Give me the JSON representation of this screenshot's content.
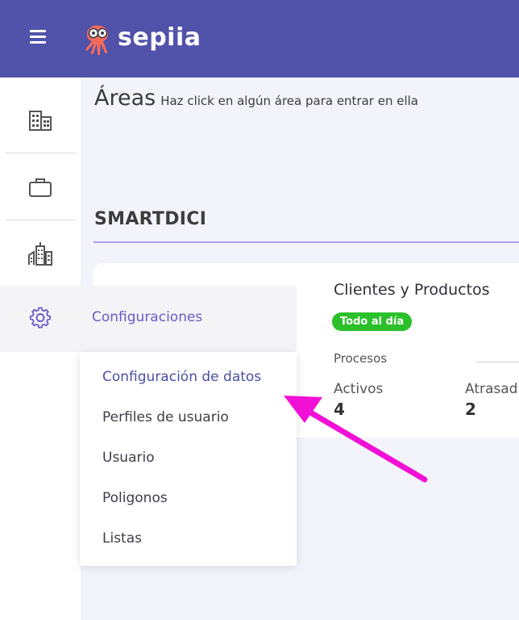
{
  "header": {
    "brand": "sepiia",
    "menu_icon": "hamburger-menu-icon",
    "logo_icon": "octopus-logo-icon",
    "background_color": "#5152a9"
  },
  "sidebar": {
    "items": [
      {
        "icon": "building-icon"
      },
      {
        "icon": "briefcase-icon"
      },
      {
        "icon": "city-buildings-icon"
      },
      {
        "icon": "gear-icon",
        "label": "Configuraciones"
      }
    ]
  },
  "main": {
    "title": "Áreas",
    "subtitle": "Haz click en algún área para entrar en ella",
    "section": "SMARTDICI",
    "card": {
      "title": "Clientes y Productos",
      "badge": "Todo al día",
      "badge_color": "#2bc02a",
      "procesos_label": "Procesos",
      "stats": [
        {
          "label": "Activos",
          "value": "4"
        },
        {
          "label": "Atrasad",
          "value": "2"
        }
      ]
    }
  },
  "config_menu": {
    "label": "Configuraciones",
    "items": [
      {
        "label": "Configuración de datos"
      },
      {
        "label": "Perfiles de usuario"
      },
      {
        "label": "Usuario"
      },
      {
        "label": "Poligonos"
      },
      {
        "label": "Listas"
      }
    ]
  },
  "annotation": {
    "arrow_color": "#f20fd6"
  }
}
